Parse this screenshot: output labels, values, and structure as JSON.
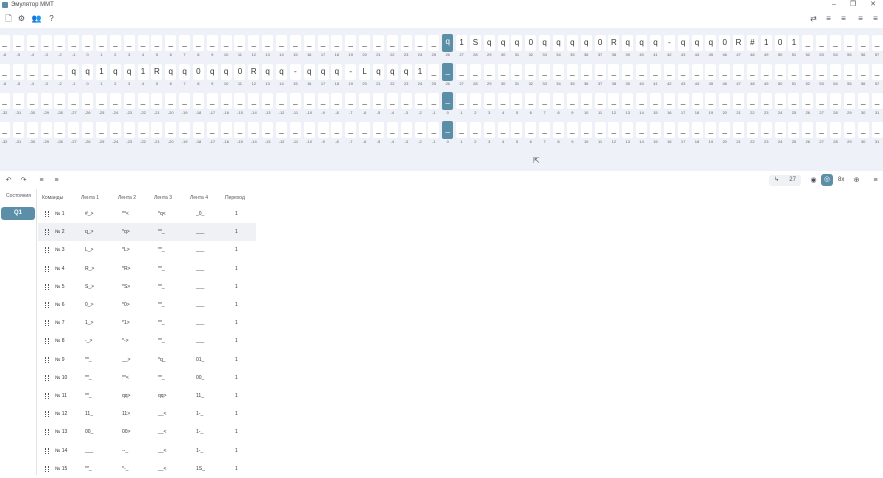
{
  "window": {
    "title": "Эмулятор ММТ",
    "minimize": "–",
    "maximize": "❐",
    "close": "✕"
  },
  "toolbar_left": [
    {
      "icon": "file-icon",
      "glyph": "🗋"
    },
    {
      "icon": "gear-icon",
      "glyph": "⚙"
    },
    {
      "icon": "users-icon",
      "glyph": "👥"
    },
    {
      "icon": "help-icon",
      "glyph": "?"
    }
  ],
  "toolbar_right": [
    {
      "icon": "import-icon",
      "glyph": "⇄"
    },
    {
      "icon": "tape-add-icon",
      "glyph": "≡"
    },
    {
      "icon": "tape-remove-icon",
      "glyph": "≡"
    },
    {
      "icon": "list-add-icon",
      "glyph": "≡"
    },
    {
      "icon": "list-remove-icon",
      "glyph": "≡"
    }
  ],
  "tapes": [
    {
      "cells": [
        "_",
        "_",
        "_",
        "_",
        "_",
        "_",
        "_",
        "_",
        "_",
        "_",
        "_",
        "_",
        "_",
        "_",
        "_",
        "_",
        "_",
        "_",
        "_",
        "_",
        "_",
        "_",
        "_",
        "_",
        "_",
        "_",
        "_",
        "_",
        "_",
        "_",
        "_",
        "_",
        "q",
        "1",
        "S",
        "q",
        "q",
        "q",
        "0",
        "q",
        "q",
        "q",
        "q",
        "0",
        "R",
        "q",
        "q",
        "q",
        "-",
        "q",
        "q",
        "q",
        "0",
        "R",
        "#",
        "1",
        "0",
        "1",
        "_",
        "_",
        "_",
        "_",
        "_",
        "_"
      ],
      "indices": [
        "-6",
        "-5",
        "-4",
        "-3",
        "-2",
        "-1",
        "0",
        "1",
        "2",
        "3",
        "4",
        "5",
        "6",
        "7",
        "8",
        "9",
        "10",
        "11",
        "12",
        "13",
        "14",
        "15",
        "16",
        "17",
        "18",
        "19",
        "20",
        "21",
        "22",
        "23",
        "24",
        "25",
        "26",
        "27",
        "28",
        "29",
        "30",
        "31",
        "32",
        "33",
        "34",
        "35",
        "36",
        "37",
        "38",
        "39",
        "40",
        "41",
        "42",
        "43",
        "44",
        "45",
        "46",
        "47",
        "48",
        "49",
        "50",
        "51",
        "52",
        "53",
        "54",
        "55",
        "56",
        "57"
      ],
      "head": 32
    },
    {
      "cells": [
        "_",
        "_",
        "_",
        "_",
        "_",
        "q",
        "q",
        "1",
        "q",
        "q",
        "1",
        "R",
        "q",
        "q",
        "0",
        "q",
        "q",
        "0",
        "R",
        "q",
        "q",
        "-",
        "q",
        "q",
        "q",
        "-",
        "L",
        "q",
        "q",
        "q",
        "1",
        "_",
        "_",
        "_",
        "_",
        "_",
        "_",
        "_",
        "_",
        "_",
        "_",
        "_",
        "_",
        "_",
        "_",
        "_",
        "_",
        "_",
        "_",
        "_",
        "_",
        "_",
        "_",
        "_",
        "_",
        "_",
        "_",
        "_",
        "_",
        "_",
        "_",
        "_",
        "_",
        "_"
      ],
      "indices": [
        "-6",
        "-5",
        "-4",
        "-3",
        "-2",
        "-1",
        "0",
        "1",
        "2",
        "3",
        "4",
        "5",
        "6",
        "7",
        "8",
        "9",
        "10",
        "11",
        "12",
        "13",
        "14",
        "15",
        "16",
        "17",
        "18",
        "19",
        "20",
        "21",
        "22",
        "23",
        "24",
        "25",
        "26",
        "27",
        "28",
        "29",
        "30",
        "31",
        "32",
        "33",
        "34",
        "35",
        "36",
        "37",
        "38",
        "39",
        "40",
        "41",
        "42",
        "43",
        "44",
        "45",
        "46",
        "47",
        "48",
        "49",
        "50",
        "51",
        "52",
        "53",
        "54",
        "55",
        "56",
        "57"
      ],
      "head": 32
    },
    {
      "cells": [
        "_",
        "_",
        "_",
        "_",
        "_",
        "_",
        "_",
        "_",
        "_",
        "_",
        "_",
        "_",
        "_",
        "_",
        "_",
        "_",
        "_",
        "_",
        "_",
        "_",
        "_",
        "_",
        "_",
        "_",
        "_",
        "_",
        "_",
        "_",
        "_",
        "_",
        "_",
        "_",
        "_",
        "_",
        "_",
        "_",
        "_",
        "_",
        "_",
        "_",
        "_",
        "_",
        "_",
        "_",
        "_",
        "_",
        "_",
        "_",
        "_",
        "_",
        "_",
        "_",
        "_",
        "_",
        "_",
        "_",
        "_",
        "_",
        "_",
        "_",
        "_",
        "_",
        "_",
        "_"
      ],
      "indices": [
        "-32",
        "-31",
        "-30",
        "-29",
        "-28",
        "-27",
        "-26",
        "-25",
        "-24",
        "-23",
        "-22",
        "-21",
        "-20",
        "-19",
        "-18",
        "-17",
        "-16",
        "-15",
        "-14",
        "-13",
        "-12",
        "-11",
        "-10",
        "-9",
        "-8",
        "-7",
        "-6",
        "-5",
        "-4",
        "-3",
        "-2",
        "-1",
        "0",
        "1",
        "2",
        "3",
        "4",
        "5",
        "6",
        "7",
        "8",
        "9",
        "10",
        "11",
        "12",
        "13",
        "14",
        "15",
        "16",
        "17",
        "18",
        "19",
        "20",
        "21",
        "22",
        "23",
        "24",
        "25",
        "26",
        "27",
        "28",
        "29",
        "30",
        "31"
      ],
      "head": 32
    },
    {
      "cells": [
        "_",
        "_",
        "_",
        "_",
        "_",
        "_",
        "_",
        "_",
        "_",
        "_",
        "_",
        "_",
        "_",
        "_",
        "_",
        "_",
        "_",
        "_",
        "_",
        "_",
        "_",
        "_",
        "_",
        "_",
        "_",
        "_",
        "_",
        "_",
        "_",
        "_",
        "_",
        "_",
        "_",
        "_",
        "_",
        "_",
        "_",
        "_",
        "_",
        "_",
        "_",
        "_",
        "_",
        "_",
        "_",
        "_",
        "_",
        "_",
        "_",
        "_",
        "_",
        "_",
        "_",
        "_",
        "_",
        "_",
        "_",
        "_",
        "_",
        "_",
        "_",
        "_",
        "_",
        "_"
      ],
      "indices": [
        "-32",
        "-31",
        "-30",
        "-29",
        "-28",
        "-27",
        "-26",
        "-25",
        "-24",
        "-23",
        "-22",
        "-21",
        "-20",
        "-19",
        "-18",
        "-17",
        "-16",
        "-15",
        "-14",
        "-13",
        "-12",
        "-11",
        "-10",
        "-9",
        "-8",
        "-7",
        "-6",
        "-5",
        "-4",
        "-3",
        "-2",
        "-1",
        "0",
        "1",
        "2",
        "3",
        "4",
        "5",
        "6",
        "7",
        "8",
        "9",
        "10",
        "11",
        "12",
        "13",
        "14",
        "15",
        "16",
        "17",
        "18",
        "19",
        "20",
        "21",
        "22",
        "23",
        "24",
        "25",
        "26",
        "27",
        "28",
        "29",
        "30",
        "31"
      ],
      "head": 32
    }
  ],
  "controls": {
    "left_icons": [
      {
        "icon": "undo-icon",
        "glyph": "↶"
      },
      {
        "icon": "redo-icon",
        "glyph": "↷"
      },
      {
        "icon": "add-row-icon",
        "glyph": "≡"
      },
      {
        "icon": "remove-row-icon",
        "glyph": "≡"
      }
    ],
    "step_icon": "↳",
    "step_count": "27",
    "speed": "8x",
    "speed_icon_glyph": "⊕",
    "menu_icon_glyph": "≡",
    "play_glyph": "◉",
    "record_glyph": "◎"
  },
  "states_header": "Состояния",
  "states": [
    "Q1"
  ],
  "table": {
    "headers": [
      "Команды",
      "Лента 1",
      "Лента 2",
      "Лента 3",
      "Лента 4",
      "Переход"
    ],
    "rows": [
      {
        "cmd": "№ 1",
        "t1": "#_>",
        "t2": "**<",
        "t3": "*q<",
        "t4": "_0_",
        "next": "1"
      },
      {
        "cmd": "№ 2",
        "t1": "q_>",
        "t2": "*q>",
        "t3": "**_",
        "t4": "___",
        "next": "1"
      },
      {
        "cmd": "№ 3",
        "t1": "L_>",
        "t2": "*L>",
        "t3": "**_",
        "t4": "___",
        "next": "1"
      },
      {
        "cmd": "№ 4",
        "t1": "R_>",
        "t2": "*R>",
        "t3": "**_",
        "t4": "___",
        "next": "1"
      },
      {
        "cmd": "№ 5",
        "t1": "S_>",
        "t2": "*S>",
        "t3": "**_",
        "t4": "___",
        "next": "1"
      },
      {
        "cmd": "№ 6",
        "t1": "0_>",
        "t2": "*0>",
        "t3": "**_",
        "t4": "___",
        "next": "1"
      },
      {
        "cmd": "№ 7",
        "t1": "1_>",
        "t2": "*1>",
        "t3": "**_",
        "t4": "___",
        "next": "1"
      },
      {
        "cmd": "№ 8",
        "t1": "-_>",
        "t2": "*->",
        "t3": "**_",
        "t4": "___",
        "next": "1"
      },
      {
        "cmd": "№ 9",
        "t1": "**_",
        "t2": "__>",
        "t3": "*q_",
        "t4": "01_",
        "next": "1"
      },
      {
        "cmd": "№ 10",
        "t1": "**_",
        "t2": "**<",
        "t3": "**_",
        "t4": "00_",
        "next": "1"
      },
      {
        "cmd": "№ 11",
        "t1": "**_",
        "t2": "qq>",
        "t3": "qq>",
        "t4": "11_",
        "next": "1"
      },
      {
        "cmd": "№ 12",
        "t1": "11_",
        "t2": "11>",
        "t3": "__<",
        "t4": "1-_",
        "next": "1"
      },
      {
        "cmd": "№ 13",
        "t1": "00_",
        "t2": "00>",
        "t3": "__<",
        "t4": "1-_",
        "next": "1"
      },
      {
        "cmd": "№ 14",
        "t1": "___",
        "t2": "--_",
        "t3": "__<",
        "t4": "1-_",
        "next": "1"
      },
      {
        "cmd": "№ 15",
        "t1": "**_",
        "t2": "*-_",
        "t3": "__<",
        "t4": "1S_",
        "next": "1"
      }
    ],
    "selected_row": 1
  }
}
